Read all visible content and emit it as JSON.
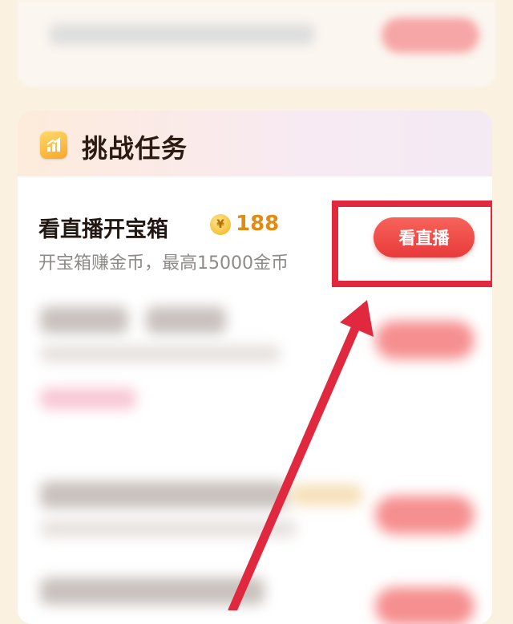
{
  "section": {
    "title": "挑战任务",
    "icon": "chart-icon"
  },
  "task": {
    "title": "看直播开宝箱",
    "coin_symbol": "¥",
    "reward": "188",
    "subtitle": "开宝箱赚金币，最高15000金币",
    "button_label": "看直播"
  },
  "colors": {
    "accent_red": "#e83a3a",
    "highlight_red": "#e0283f",
    "reward_orange": "#e28a12"
  }
}
